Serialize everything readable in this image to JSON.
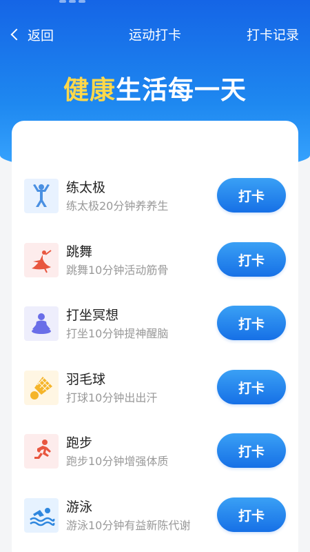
{
  "header": {
    "back_label": "返回",
    "title": "运动打卡",
    "records_label": "打卡记录"
  },
  "headline": {
    "highlight": "健康",
    "rest": "生活每一天"
  },
  "items": [
    {
      "name": "练太极",
      "desc": "练太极20分钟养养生",
      "button": "打卡",
      "icon": "taichi-icon"
    },
    {
      "name": "跳舞",
      "desc": "跳舞10分钟活动筋骨",
      "button": "打卡",
      "icon": "dance-icon"
    },
    {
      "name": "打坐冥想",
      "desc": "打坐10分钟提神醒脑",
      "button": "打卡",
      "icon": "meditation-icon"
    },
    {
      "name": "羽毛球",
      "desc": "打球10分钟出出汗",
      "button": "打卡",
      "icon": "badminton-icon"
    },
    {
      "name": "跑步",
      "desc": "跑步10分钟增强体质",
      "button": "打卡",
      "icon": "running-icon"
    },
    {
      "name": "游泳",
      "desc": "游泳10分钟有益新陈代谢",
      "button": "打卡",
      "icon": "swimming-icon"
    }
  ],
  "colors": {
    "primary": "#1e7ff0",
    "headline_highlight": "#ffd84a"
  }
}
